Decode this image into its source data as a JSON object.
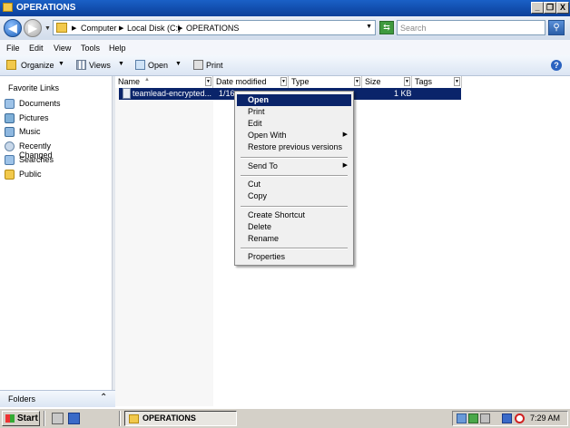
{
  "window": {
    "title": "OPERATIONS",
    "controls": {
      "minimize": "_",
      "restore": "❐",
      "close": "X"
    }
  },
  "address": {
    "breadcrumbs": [
      "Computer",
      "Local Disk (C:)",
      "OPERATIONS"
    ],
    "search_placeholder": "Search"
  },
  "menubar": [
    "File",
    "Edit",
    "View",
    "Tools",
    "Help"
  ],
  "toolbar": {
    "organize": "Organize",
    "views": "Views",
    "open": "Open",
    "print": "Print"
  },
  "sidebar": {
    "title": "Favorite Links",
    "items": [
      {
        "label": "Documents",
        "icon": "documents-icon"
      },
      {
        "label": "Pictures",
        "icon": "pictures-icon"
      },
      {
        "label": "Music",
        "icon": "music-icon"
      },
      {
        "label": "Recently Changed",
        "icon": "recently-changed-icon"
      },
      {
        "label": "Searches",
        "icon": "searches-icon"
      },
      {
        "label": "Public",
        "icon": "public-folder-icon"
      }
    ],
    "folders_label": "Folders"
  },
  "columns": [
    "Name",
    "Date modified",
    "Type",
    "Size",
    "Tags"
  ],
  "files": [
    {
      "name": "teamlead-encrypted...",
      "date": "1/16",
      "size": "1 KB"
    }
  ],
  "context_menu": {
    "groups": [
      [
        "Open",
        "Print",
        "Edit",
        "Open With",
        "Restore previous versions"
      ],
      [
        "Send To"
      ],
      [
        "Cut",
        "Copy"
      ],
      [
        "Create Shortcut",
        "Delete",
        "Rename"
      ],
      [
        "Properties"
      ]
    ],
    "selected": "Open",
    "submenu_items": [
      "Open With",
      "Send To"
    ]
  },
  "taskbar": {
    "start": "Start",
    "task": "OPERATIONS",
    "clock": "7:29 AM"
  },
  "colors": {
    "selection": "#0a246a",
    "titlebar": "#1a60c6",
    "taskbar": "#d4d0c8"
  }
}
